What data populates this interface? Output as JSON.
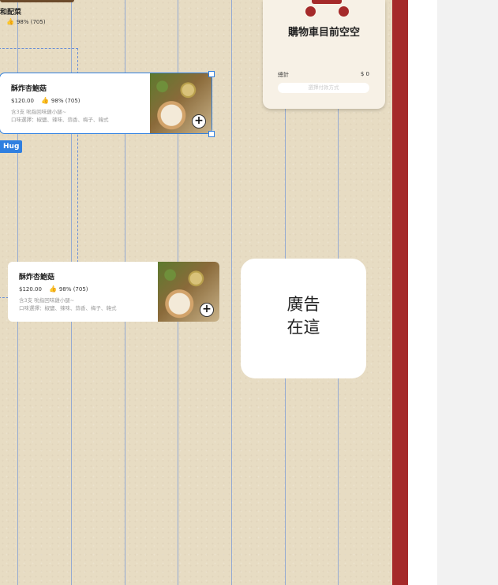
{
  "top_item": {
    "title": "和配菜",
    "rating_text": "98% (705)"
  },
  "card_selected": {
    "name": "酥炸杏鮑菇",
    "price": "$120.00",
    "rating_text": "98% (705)",
    "desc_line1": "含3支 吮指回味雞小腿~",
    "desc_line2": "口味選擇：椒鹽、辣味、蒜香、梅子、韓式",
    "add_label": "+"
  },
  "hug_badge": "Hug",
  "card_second": {
    "name": "酥炸杏鮑菇",
    "price": "$120.00",
    "rating_text": "98% (705)",
    "desc_line1": "含3支 吮指回味雞小腿~",
    "desc_line2": "口味選擇：椒鹽、辣味、蒜香、梅子、韓式",
    "add_label": "+"
  },
  "cart": {
    "title": "購物車目前空空",
    "total_label": "總計",
    "total_value": "$ 0",
    "pay_button": "選擇付款方式"
  },
  "ad": {
    "line1": "廣告",
    "line2": "在這"
  },
  "colors": {
    "accent_red": "#a52a2a",
    "selection_blue": "#2f7fe0",
    "paper": "#e7dcc3"
  }
}
